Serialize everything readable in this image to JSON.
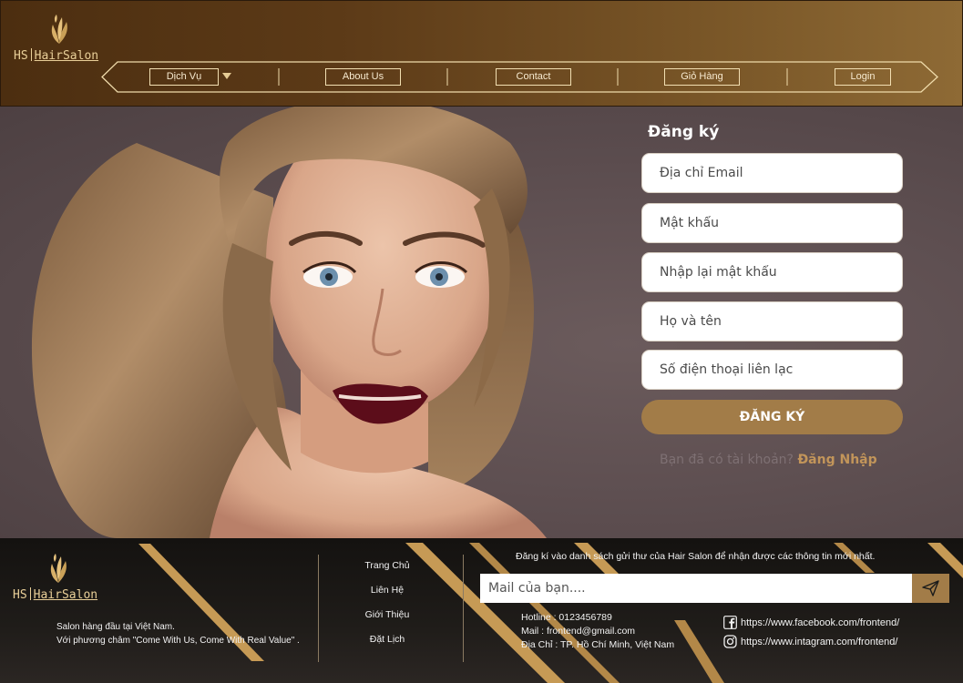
{
  "header": {
    "logo": {
      "abbr": "HS",
      "name": "HairSalon"
    },
    "nav": [
      {
        "label": "Dịch Vụ",
        "has_dropdown": true
      },
      {
        "label": "About Us"
      },
      {
        "label": "Contact"
      },
      {
        "label": "Giỏ Hàng"
      },
      {
        "label": "Login"
      }
    ]
  },
  "form": {
    "title": "Đăng ký",
    "fields": [
      {
        "placeholder": "Địa chỉ Email"
      },
      {
        "placeholder": "Mật khẩu"
      },
      {
        "placeholder": "Nhập lại mật khẩu"
      },
      {
        "placeholder": "Họ và tên"
      },
      {
        "placeholder": "Số điện thoại liên lạc"
      }
    ],
    "submit_label": "ĐĂNG KÝ",
    "login_prompt": "Bạn đã có tài khoản?",
    "login_link": "Đăng Nhập"
  },
  "footer": {
    "logo": {
      "abbr": "HS",
      "name": "HairSalon"
    },
    "tagline": [
      "Salon hàng đầu tại Việt Nam.",
      "Với phương châm \"Come With Us, Come With Real Value\" ."
    ],
    "links": [
      "Trang Chủ",
      "Liên Hệ",
      "Giới Thiệu",
      "Đặt Lịch"
    ],
    "newsletter_text": "Đăng kí vào danh sách gửi thư của Hair Salon để nhận được các thông tin mới nhất.",
    "mail_placeholder": "Mail của bạn....",
    "contact": [
      "Hotline : 0123456789",
      "Mail : frontend@gmail.com",
      "Địa Chỉ : TP. Hồ Chí Minh, Việt Nam"
    ],
    "social": [
      {
        "icon": "facebook-icon",
        "url": "https://www.facebook.com/frontend/"
      },
      {
        "icon": "instagram-icon",
        "url": "https://www.intagram.com/frontend/"
      }
    ]
  },
  "colors": {
    "gold": "#a27c48",
    "gold_light": "#e9cf98",
    "header_dark": "#4c2e10",
    "footer_dark": "#141210"
  }
}
